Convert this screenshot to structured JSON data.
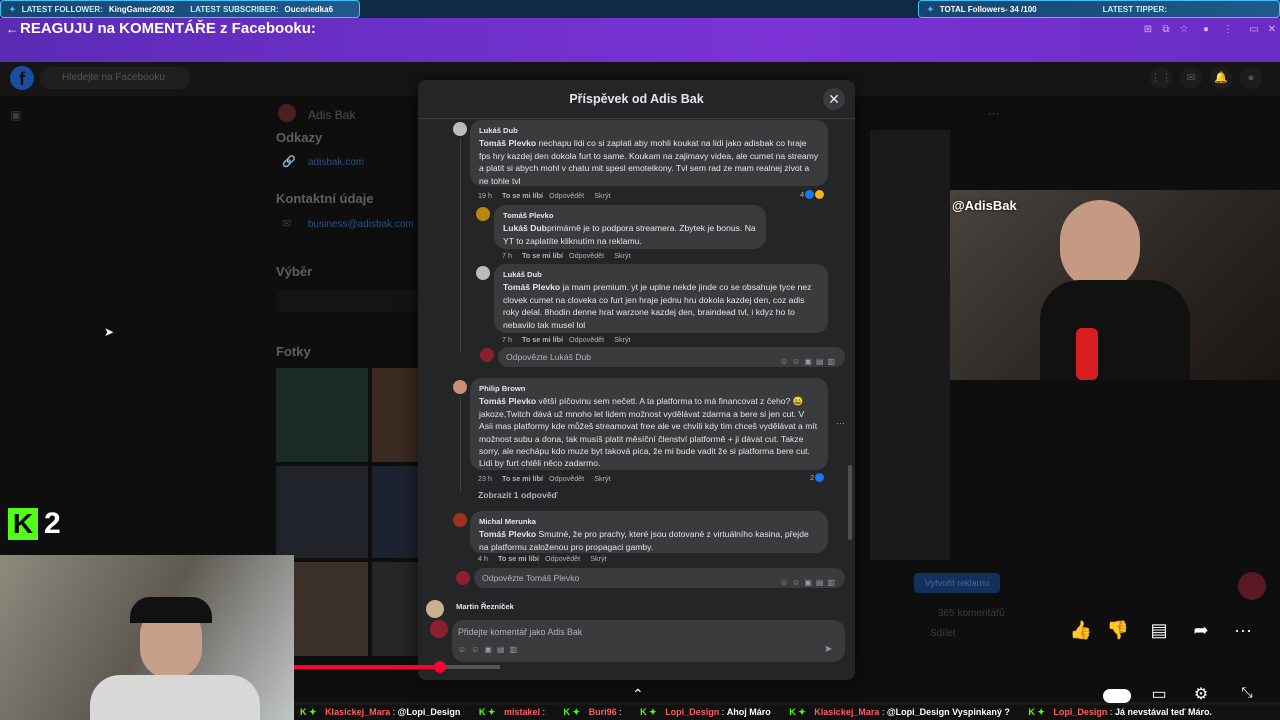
{
  "stream_overlay": {
    "latest_follower_label": "LATEST FOLLOWER:",
    "latest_follower": "KingGamer20032",
    "latest_subscriber_label": "LATEST SUBSCRIBER:",
    "latest_subscriber": "Oucoriedka6",
    "total_followers": "TOTAL Followers- 34 /100",
    "latest_tipper_label": "LATEST TIPPER:",
    "kick_viewers": "2",
    "webcam_tag": "@AdisBak"
  },
  "video": {
    "title": "REAGUJU na KOMENTÁŘE z Facebooku:"
  },
  "facebook": {
    "search_placeholder": "Hledejte na Facebooku",
    "profile_name": "Adis Bak",
    "links_heading": "Odkazy",
    "link_url": "adisbak.com",
    "contact_heading": "Kontaktní údaje",
    "contact_email": "business@adisbak.com",
    "featured_heading": "Výběr",
    "photos_heading": "Fotky",
    "ad_button": "Vytvořit reklamu",
    "comments_count": "365 komentářů",
    "share_label": "Sdílet"
  },
  "modal": {
    "title": "Příspěvek od Adis Bak",
    "close_icon": "close-icon",
    "comments": [
      {
        "author": "Lukáš Dub",
        "mention": "Tomáš Plevko",
        "text": " nechapu lidi co si zaplati aby mohli koukat na lidi jako adisbak co hraje fps hry kazdej den dokola furt to same. Koukam na zajimavy videa, ale cumet na streamy a platit si abych mohl v chatu mit spesl emoteikony. Tvl sem rad ze mam realnej zivot a ne tohle tvl",
        "time": "19 h",
        "like": "To se mi líbí",
        "reply": "Odpovědět",
        "hide": "Skrýt",
        "reactions": "4"
      },
      {
        "author": "Tomáš Plevko",
        "mention": "Lukáš Dub",
        "text": "primárně je to podpora streamera. Zbytek je bonus. Na YT to zaplatíte kliknutím na reklamu.",
        "time": "7 h",
        "like": "To se mi líbí",
        "reply": "Odpovědět",
        "hide": "Skrýt"
      },
      {
        "author": "Lukáš Dub",
        "mention": "Tomáš Plevko",
        "text": " ja mam premium. yt je uplne nekde jinde co se obsahuje tyce nez clovek cumet na cloveka co furt jen hraje jednu hru dokola kazdej den, coz adis roky delal. 8hodin denne hrat warzone kazdej den, braindead tvl, i kdyz ho to nebavilo tak musel lol",
        "time": "7 h",
        "like": "To se mi líbí",
        "reply": "Odpovědět",
        "hide": "Skrýt"
      },
      {
        "author": "Philip Brown",
        "mention": "Tomáš Plevko",
        "text": " větší píčovinu sem nečetl. A ta platforma to má financovat z čeho? 😄 jakoze,Twitch dává už mnoho let lidem možnost vydělávat zdarma a bere si jen cut. V Asii mas platformy kde můžeš streamovat free ale ve chvíli kdy tim chceš vydělávat a mít možnost subu a dona, tak musíš platit měsíční členství platformě + ji dávat cut. Takze sorry, ale nechápu kdo muze byt taková pica, že mi bude vadit že si platforma bere cut. Lidi by furt chtěli něco zadarmo.",
        "time": "23 h",
        "like": "To se mi líbí",
        "reply": "Odpovědět",
        "hide": "Skrýt",
        "reactions": "2"
      },
      {
        "author": "Michal Merunka",
        "mention": "Tomáš Plevko",
        "text": " Smutné, že pro prachy, které jsou dotované z virtuálního kasina, přejde na platformu založenou pro propagaci gamby.",
        "time": "4 h",
        "like": "To se mi líbí",
        "reply": "Odpovědět",
        "hide": "Skrýt"
      }
    ],
    "reply_to_lukas": "Odpovězte Lukáš Dub",
    "show_replies": "Zobrazit 1 odpověď",
    "reply_to_tomas": "Odpovězte Tomáš Plevko",
    "next_author": "Martin Řezníček",
    "compose_placeholder": "Přidejte komentář jako Adis Bak"
  },
  "chat_ticker": [
    {
      "name": "Klasickej_Mara",
      "msg": "@Lopi_Design"
    },
    {
      "name": "mistakel",
      "msg": ""
    },
    {
      "name": "Buri96",
      "msg": ""
    },
    {
      "name": "Lopi_Design",
      "msg": "Ahoj Máro"
    },
    {
      "name": "Klasickej_Mara",
      "msg": "@Lopi_Design Vyspinkaný ?"
    },
    {
      "name": "Lopi_Design",
      "msg": "Já nevstával teď Máro."
    }
  ],
  "colors": {
    "overlay_purple": "#7b33d6",
    "kick_green": "#53fc18",
    "facebook_blue": "#1877f2",
    "youtube_red": "#ff0033"
  },
  "playback": {
    "progress_fraction": 0.71
  }
}
